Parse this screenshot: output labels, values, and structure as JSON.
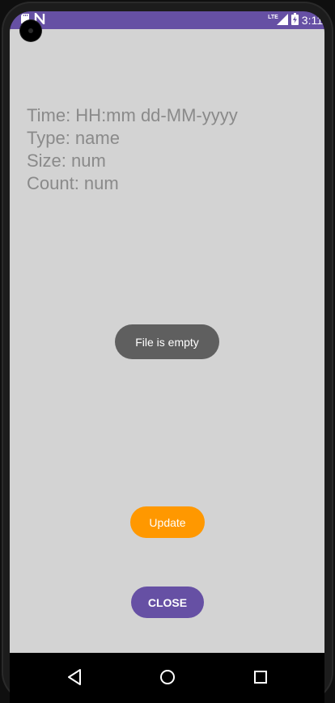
{
  "status_bar": {
    "time": "3:11",
    "network_label": "LTE",
    "icons": [
      "sd-card-icon",
      "n-notification-icon",
      "signal-icon",
      "battery-charging-icon"
    ]
  },
  "info": {
    "time_line": "Time: HH:mm dd-MM-yyyy",
    "type_line": "Type: name",
    "size_line": "Size: num",
    "count_line": "Count: num"
  },
  "toast": {
    "message": "File is empty"
  },
  "buttons": {
    "update_label": "Update",
    "close_label": "CLOSE"
  },
  "nav": {
    "icons": [
      "back-icon",
      "home-icon",
      "recents-icon"
    ]
  },
  "colors": {
    "primary": "#6650a4",
    "accent": "#ff9800",
    "background": "#d3d3d3",
    "toast": "#5f5f5f",
    "text_muted": "#8a8a8a"
  }
}
